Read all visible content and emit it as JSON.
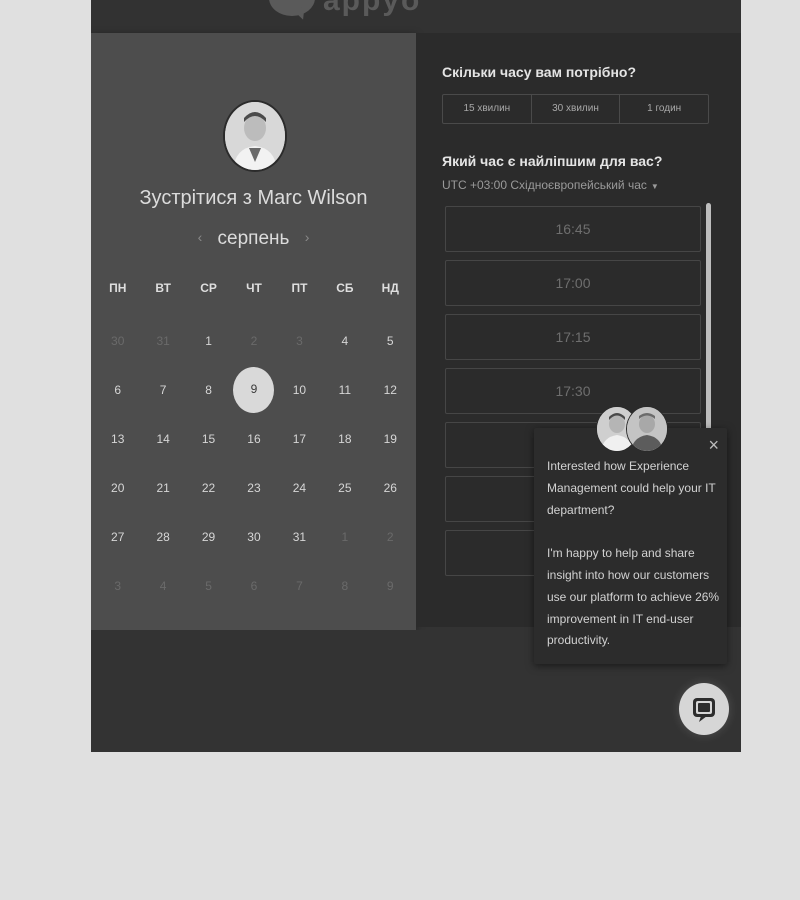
{
  "header": {
    "logo_text": "appyo"
  },
  "calendar": {
    "meet_title": "Зустрітися з Marc Wilson",
    "month": "серпень",
    "prev_arrow": "‹",
    "next_arrow": "›",
    "weekdays": [
      "ПН",
      "ВТ",
      "СР",
      "ЧТ",
      "ПТ",
      "СБ",
      "НД"
    ],
    "days": [
      {
        "d": "30",
        "dim": true
      },
      {
        "d": "31",
        "dim": true
      },
      {
        "d": "1"
      },
      {
        "d": "2",
        "dim": true
      },
      {
        "d": "3",
        "dim": true
      },
      {
        "d": "4"
      },
      {
        "d": "5"
      },
      {
        "d": "6"
      },
      {
        "d": "7"
      },
      {
        "d": "8"
      },
      {
        "d": "9",
        "selected": true
      },
      {
        "d": "10"
      },
      {
        "d": "11"
      },
      {
        "d": "12"
      },
      {
        "d": "13"
      },
      {
        "d": "14"
      },
      {
        "d": "15"
      },
      {
        "d": "16"
      },
      {
        "d": "17"
      },
      {
        "d": "18"
      },
      {
        "d": "19"
      },
      {
        "d": "20"
      },
      {
        "d": "21"
      },
      {
        "d": "22"
      },
      {
        "d": "23"
      },
      {
        "d": "24"
      },
      {
        "d": "25"
      },
      {
        "d": "26"
      },
      {
        "d": "27"
      },
      {
        "d": "28"
      },
      {
        "d": "29"
      },
      {
        "d": "30"
      },
      {
        "d": "31"
      },
      {
        "d": "1",
        "dim": true
      },
      {
        "d": "2",
        "dim": true
      },
      {
        "d": "3",
        "dim": true
      },
      {
        "d": "4",
        "dim": true
      },
      {
        "d": "5",
        "dim": true
      },
      {
        "d": "6",
        "dim": true
      },
      {
        "d": "7",
        "dim": true
      },
      {
        "d": "8",
        "dim": true
      },
      {
        "d": "9",
        "dim": true
      }
    ]
  },
  "booking": {
    "duration_question": "Скільки часу вам потрібно?",
    "durations": [
      "15 хвилин",
      "30 хвилин",
      "1 годин"
    ],
    "time_question": "Який час є найліпшим для вас?",
    "timezone": "UTC +03:00 Східноєвропейський час",
    "slots": [
      "16:45",
      "17:00",
      "17:15",
      "17:30",
      "",
      "",
      "",
      ""
    ]
  },
  "chat": {
    "close_icon": "×",
    "message_1": "Interested how Experience Management could help your IT department?",
    "message_2": "I'm happy to help and share insight into how our customers use our platform to achieve 26% improvement in IT end-user productivity."
  }
}
